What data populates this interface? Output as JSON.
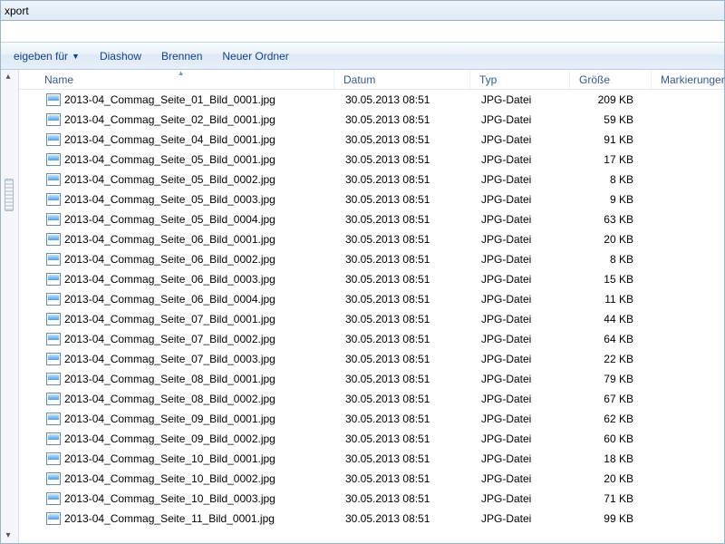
{
  "title": "xport",
  "toolbar": {
    "share_label": "eigeben für",
    "slideshow_label": "Diashow",
    "burn_label": "Brennen",
    "newfolder_label": "Neuer Ordner"
  },
  "columns": {
    "name": "Name",
    "date": "Datum",
    "type": "Typ",
    "size": "Größe",
    "tags": "Markierungen"
  },
  "files": [
    {
      "name": "2013-04_Commag_Seite_01_Bild_0001.jpg",
      "date": "30.05.2013 08:51",
      "type": "JPG-Datei",
      "size": "209 KB"
    },
    {
      "name": "2013-04_Commag_Seite_02_Bild_0001.jpg",
      "date": "30.05.2013 08:51",
      "type": "JPG-Datei",
      "size": "59 KB"
    },
    {
      "name": "2013-04_Commag_Seite_04_Bild_0001.jpg",
      "date": "30.05.2013 08:51",
      "type": "JPG-Datei",
      "size": "91 KB"
    },
    {
      "name": "2013-04_Commag_Seite_05_Bild_0001.jpg",
      "date": "30.05.2013 08:51",
      "type": "JPG-Datei",
      "size": "17 KB"
    },
    {
      "name": "2013-04_Commag_Seite_05_Bild_0002.jpg",
      "date": "30.05.2013 08:51",
      "type": "JPG-Datei",
      "size": "8 KB"
    },
    {
      "name": "2013-04_Commag_Seite_05_Bild_0003.jpg",
      "date": "30.05.2013 08:51",
      "type": "JPG-Datei",
      "size": "9 KB"
    },
    {
      "name": "2013-04_Commag_Seite_05_Bild_0004.jpg",
      "date": "30.05.2013 08:51",
      "type": "JPG-Datei",
      "size": "63 KB"
    },
    {
      "name": "2013-04_Commag_Seite_06_Bild_0001.jpg",
      "date": "30.05.2013 08:51",
      "type": "JPG-Datei",
      "size": "20 KB"
    },
    {
      "name": "2013-04_Commag_Seite_06_Bild_0002.jpg",
      "date": "30.05.2013 08:51",
      "type": "JPG-Datei",
      "size": "8 KB"
    },
    {
      "name": "2013-04_Commag_Seite_06_Bild_0003.jpg",
      "date": "30.05.2013 08:51",
      "type": "JPG-Datei",
      "size": "15 KB"
    },
    {
      "name": "2013-04_Commag_Seite_06_Bild_0004.jpg",
      "date": "30.05.2013 08:51",
      "type": "JPG-Datei",
      "size": "11 KB"
    },
    {
      "name": "2013-04_Commag_Seite_07_Bild_0001.jpg",
      "date": "30.05.2013 08:51",
      "type": "JPG-Datei",
      "size": "44 KB"
    },
    {
      "name": "2013-04_Commag_Seite_07_Bild_0002.jpg",
      "date": "30.05.2013 08:51",
      "type": "JPG-Datei",
      "size": "64 KB"
    },
    {
      "name": "2013-04_Commag_Seite_07_Bild_0003.jpg",
      "date": "30.05.2013 08:51",
      "type": "JPG-Datei",
      "size": "22 KB"
    },
    {
      "name": "2013-04_Commag_Seite_08_Bild_0001.jpg",
      "date": "30.05.2013 08:51",
      "type": "JPG-Datei",
      "size": "79 KB"
    },
    {
      "name": "2013-04_Commag_Seite_08_Bild_0002.jpg",
      "date": "30.05.2013 08:51",
      "type": "JPG-Datei",
      "size": "67 KB"
    },
    {
      "name": "2013-04_Commag_Seite_09_Bild_0001.jpg",
      "date": "30.05.2013 08:51",
      "type": "JPG-Datei",
      "size": "62 KB"
    },
    {
      "name": "2013-04_Commag_Seite_09_Bild_0002.jpg",
      "date": "30.05.2013 08:51",
      "type": "JPG-Datei",
      "size": "60 KB"
    },
    {
      "name": "2013-04_Commag_Seite_10_Bild_0001.jpg",
      "date": "30.05.2013 08:51",
      "type": "JPG-Datei",
      "size": "18 KB"
    },
    {
      "name": "2013-04_Commag_Seite_10_Bild_0002.jpg",
      "date": "30.05.2013 08:51",
      "type": "JPG-Datei",
      "size": "20 KB"
    },
    {
      "name": "2013-04_Commag_Seite_10_Bild_0003.jpg",
      "date": "30.05.2013 08:51",
      "type": "JPG-Datei",
      "size": "71 KB"
    },
    {
      "name": "2013-04_Commag_Seite_11_Bild_0001.jpg",
      "date": "30.05.2013 08:51",
      "type": "JPG-Datei",
      "size": "99 KB"
    }
  ]
}
